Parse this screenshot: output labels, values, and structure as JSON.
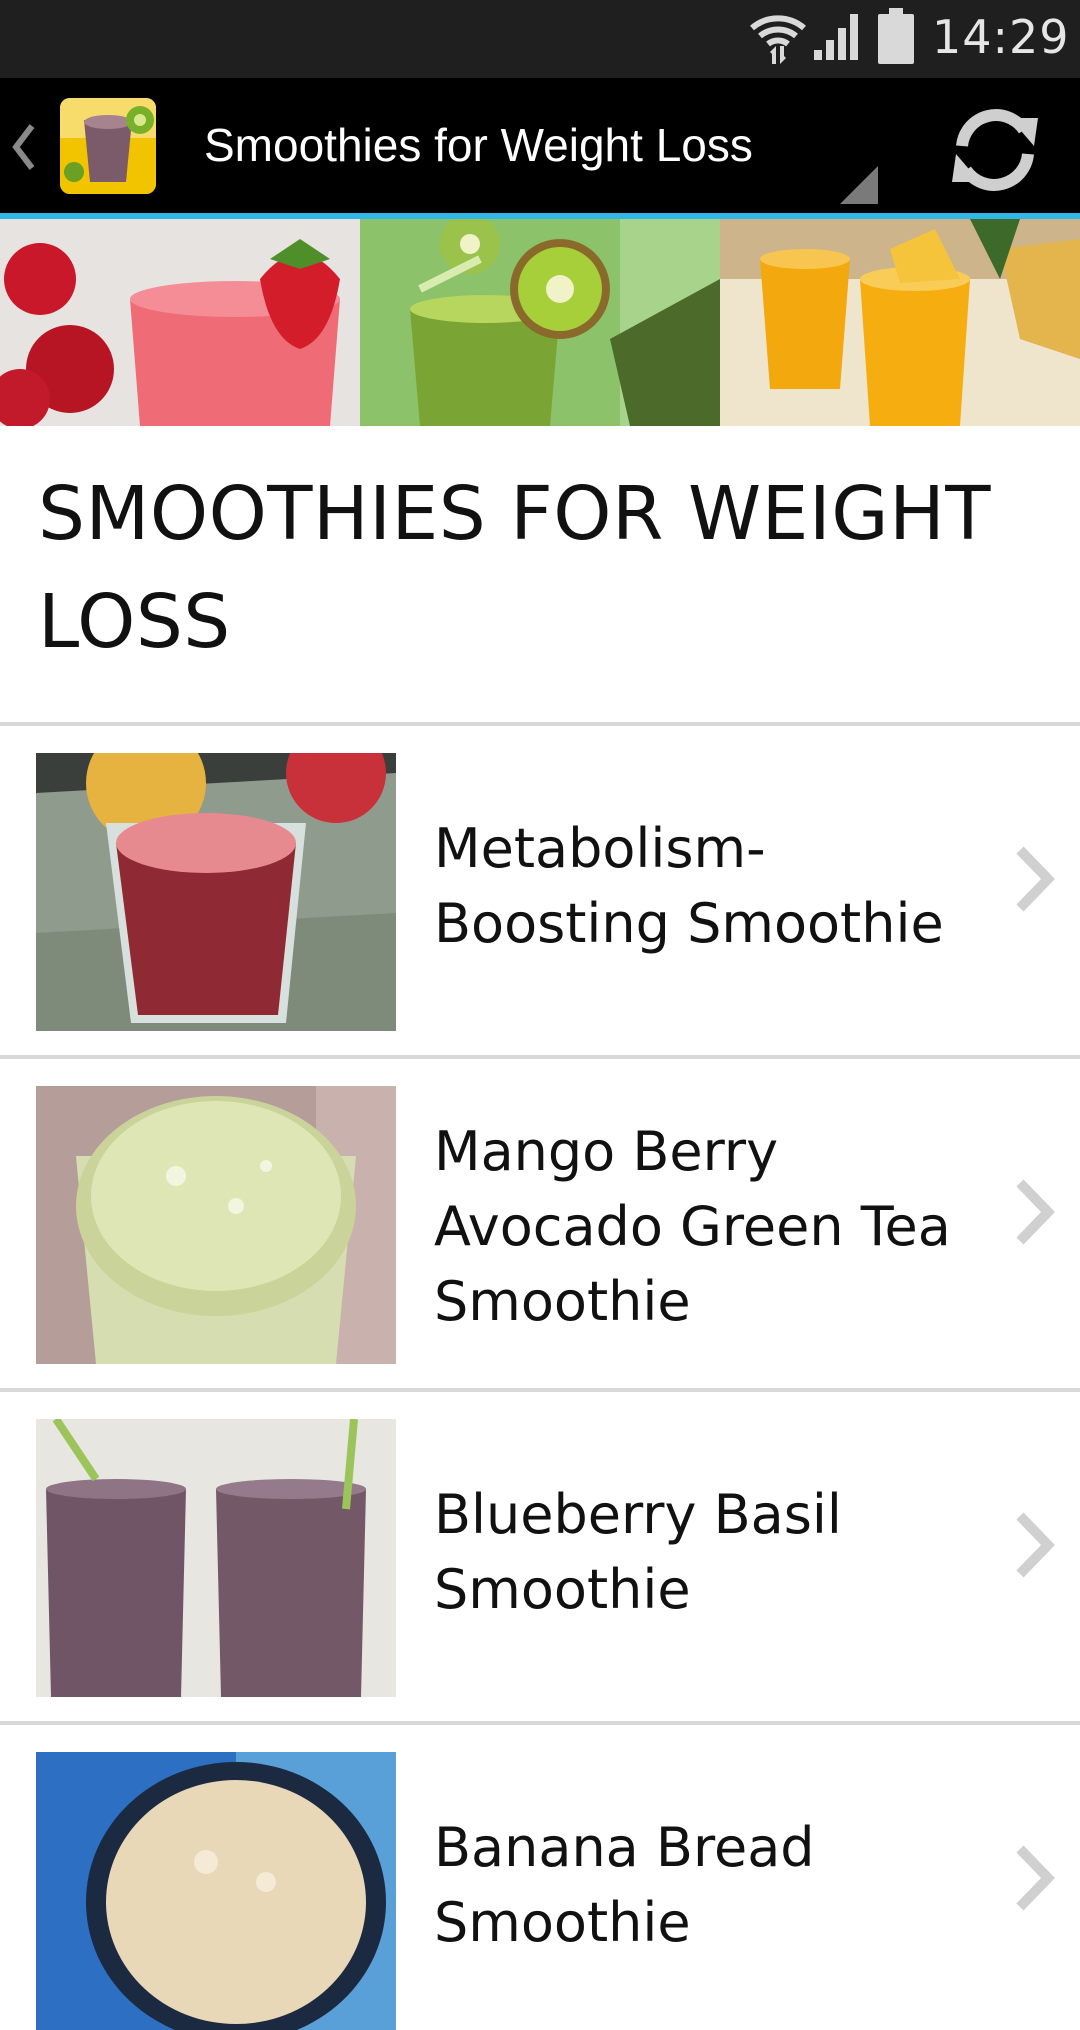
{
  "status_bar": {
    "time": "14:29",
    "icons": [
      "wifi-icon",
      "signal-icon",
      "battery-icon"
    ]
  },
  "action_bar": {
    "title": "Smoothies for Weight Loss",
    "icons": [
      "back-caret-icon",
      "app-icon",
      "dropdown-triangle-icon",
      "refresh-icon"
    ],
    "accent_color": "#33b5e5"
  },
  "banner": {
    "panels": [
      "strawberry-smoothie-image",
      "kiwi-smoothie-image",
      "pineapple-smoothie-image"
    ]
  },
  "page": {
    "heading": "SMOOTHIES FOR WEIGHT LOSS"
  },
  "recipes": [
    {
      "title": "Metabolism-Boosting Smoothie",
      "thumbnail": "red-smoothie-photo"
    },
    {
      "title": "Mango Berry Avocado Green Tea Smoothie",
      "thumbnail": "green-smoothie-photo"
    },
    {
      "title": "Blueberry Basil Smoothie",
      "thumbnail": "purple-smoothies-photo"
    },
    {
      "title": "Banana Bread Smoothie",
      "thumbnail": "banana-smoothie-photo"
    }
  ]
}
